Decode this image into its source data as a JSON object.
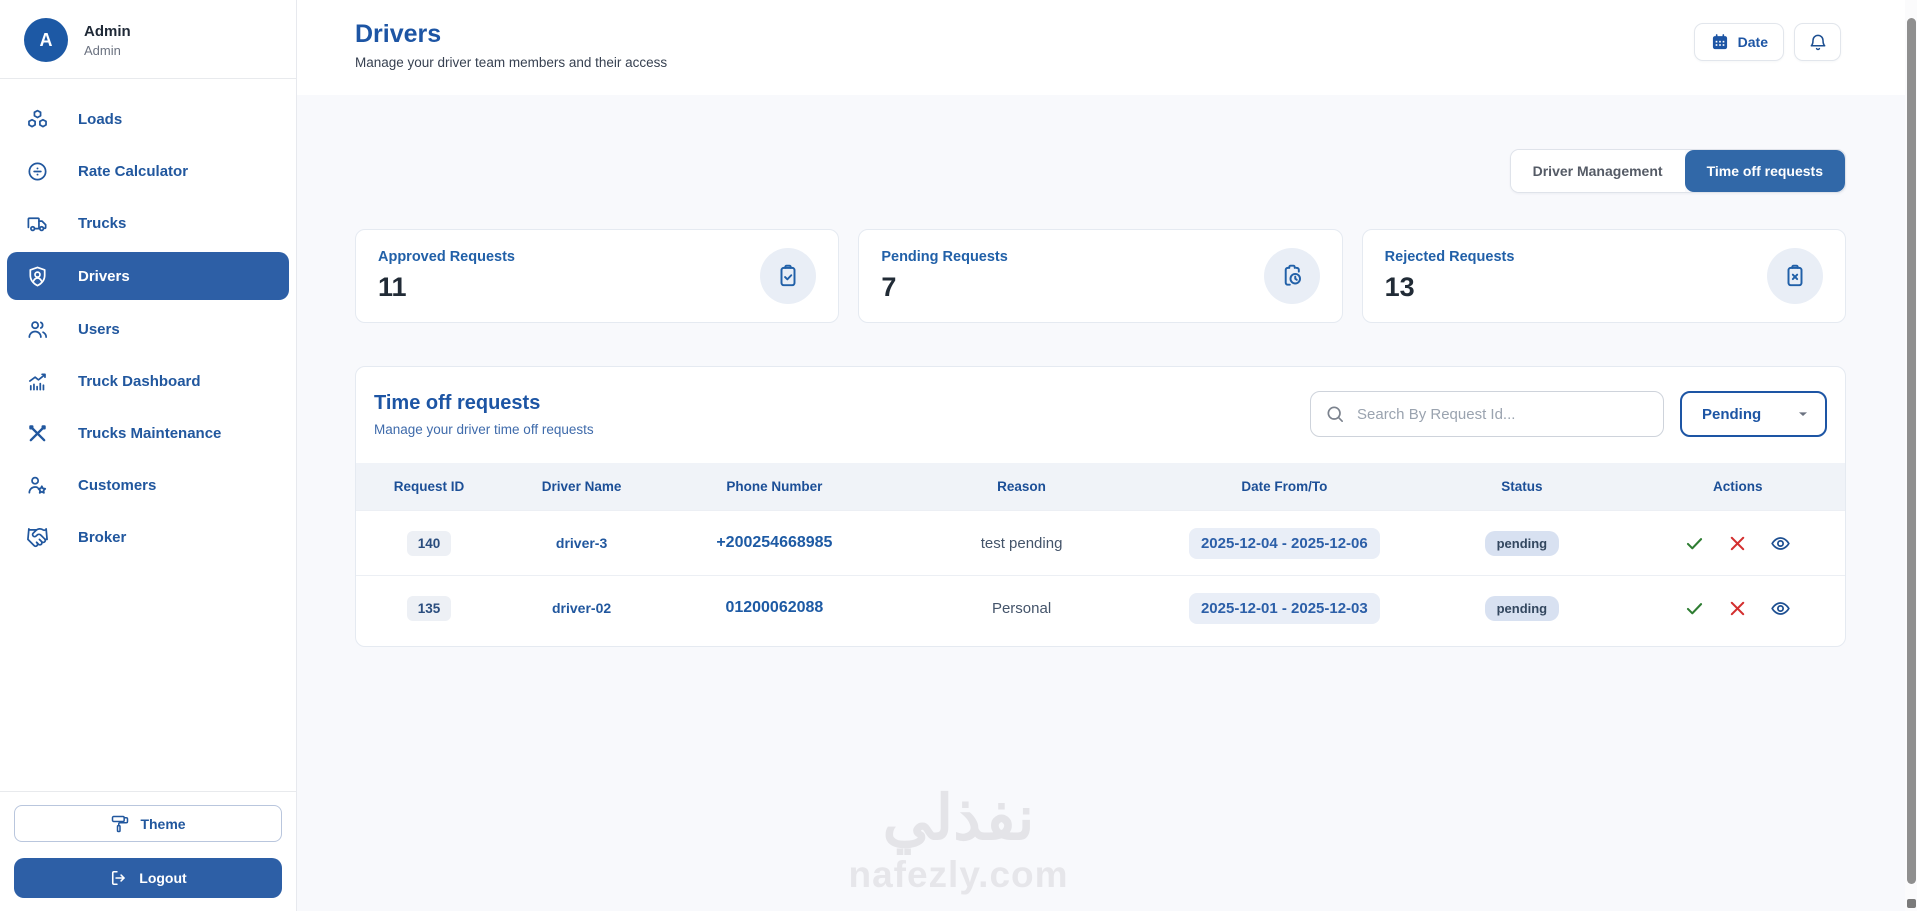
{
  "sidebar": {
    "user": {
      "initial": "A",
      "name": "Admin",
      "role": "Admin"
    },
    "items": [
      {
        "label": "Loads",
        "icon": "loads-icon"
      },
      {
        "label": "Rate Calculator",
        "icon": "rate-calculator-icon"
      },
      {
        "label": "Trucks",
        "icon": "truck-icon"
      },
      {
        "label": "Drivers",
        "icon": "shield-user-icon",
        "active": true
      },
      {
        "label": "Users",
        "icon": "users-icon"
      },
      {
        "label": "Truck Dashboard",
        "icon": "chart-icon"
      },
      {
        "label": "Trucks Maintenance",
        "icon": "tools-icon"
      },
      {
        "label": "Customers",
        "icon": "user-star-icon"
      },
      {
        "label": "Broker",
        "icon": "handshake-icon"
      }
    ],
    "theme_label": "Theme",
    "logout_label": "Logout"
  },
  "header": {
    "title": "Drivers",
    "subtitle": "Manage your driver team members and their access",
    "date_button_label": "Date"
  },
  "tabs": [
    {
      "label": "Driver Management",
      "active": false
    },
    {
      "label": "Time off requests",
      "active": true
    }
  ],
  "stats": [
    {
      "label": "Approved Requests",
      "value": "11",
      "icon": "clipboard-check-icon"
    },
    {
      "label": "Pending Requests",
      "value": "7",
      "icon": "clipboard-clock-icon"
    },
    {
      "label": "Rejected Requests",
      "value": "13",
      "icon": "clipboard-x-icon"
    }
  ],
  "requests_section": {
    "title": "Time off requests",
    "subtitle": "Manage your driver time off requests",
    "search_placeholder": "Search By Request Id...",
    "filter_value": "Pending",
    "table": {
      "columns": [
        "Request ID",
        "Driver Name",
        "Phone Number",
        "Reason",
        "Date From/To",
        "Status",
        "Actions"
      ],
      "rows": [
        {
          "request_id": "140",
          "driver_name": "driver-3",
          "phone": "+200254668985",
          "reason": "test pending",
          "date_range": "2025-12-04 - 2025-12-06",
          "status": "pending"
        },
        {
          "request_id": "135",
          "driver_name": "driver-02",
          "phone": "01200062088",
          "reason": "Personal",
          "date_range": "2025-12-01 - 2025-12-03",
          "status": "pending"
        }
      ]
    }
  },
  "watermark": {
    "arabic": "نفذلي",
    "domain": "nafezly.com"
  },
  "colors": {
    "primary": "#1d55a4",
    "active_nav": "#2d5fa6",
    "toggle_active": "#3168a8",
    "approve": "#2e7d32",
    "reject": "#d32f2f",
    "status_badge_bg": "#d8e1f1"
  }
}
